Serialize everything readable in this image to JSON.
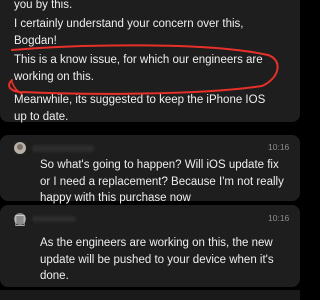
{
  "thread": {
    "support_reply_1": {
      "line1": "you by this.",
      "line2": "I certainly understand your concern over this,",
      "line3": "Bogdan!",
      "highlight": "This is a know issue, for which our engineers are working on this.",
      "line5": "Meanwhile, its suggested to keep the iPhone IOS up to date."
    },
    "user_message": {
      "time": "10:16",
      "text": "So what's going to happen? Will iOS update fix or I need a replacement? Because I'm not really happy with this purchase now"
    },
    "support_reply_2": {
      "time": "10:16",
      "text": "As the engineers are working on this, the new update will be pushed to your device when it's done."
    }
  },
  "colors": {
    "background": "#000000",
    "bubble": "#1e1e1e",
    "highlight_stroke": "#e8302a",
    "text": "#efefef",
    "timestamp": "#8e8e8e"
  },
  "icons": [
    "user-avatar-icon",
    "apple-support-avatar-icon"
  ]
}
